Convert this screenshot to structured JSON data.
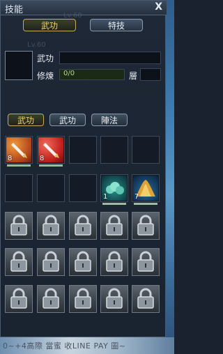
{
  "window": {
    "title": "技能",
    "close_label": "X"
  },
  "ghost_texts": [
    "Lv.60",
    "Lv.60"
  ],
  "top_tabs": [
    {
      "label": "武功",
      "active": true
    },
    {
      "label": "特技",
      "active": false
    }
  ],
  "skill_info": {
    "name_label": "武功",
    "name_value": "",
    "train_label": "修煉",
    "progress_text": "0/0",
    "progress_fraction": 0,
    "layer_label": "層"
  },
  "category_tabs": [
    {
      "label": "武功",
      "active": true
    },
    {
      "label": "武功",
      "active": false
    },
    {
      "label": "陣法",
      "active": false
    }
  ],
  "skill_slots": [
    {
      "icon": "sword-orange-icon",
      "count": "8"
    },
    {
      "icon": "sword-red-icon",
      "count": "8"
    },
    {
      "icon": "",
      "count": ""
    },
    {
      "icon": "",
      "count": ""
    },
    {
      "icon": "",
      "count": ""
    },
    {
      "icon": "",
      "count": ""
    },
    {
      "icon": "",
      "count": ""
    },
    {
      "icon": "",
      "count": ""
    },
    {
      "icon": "cloud-skill-icon",
      "count": "1"
    },
    {
      "icon": "wave-skill-icon",
      "count": "7"
    }
  ],
  "locked_slot_count": 15,
  "background_text": "0~+4高際 當蜜 收LINE PAY 圖~",
  "colors": {
    "active_text": "#f2d45f",
    "progress": "#74a04d"
  }
}
